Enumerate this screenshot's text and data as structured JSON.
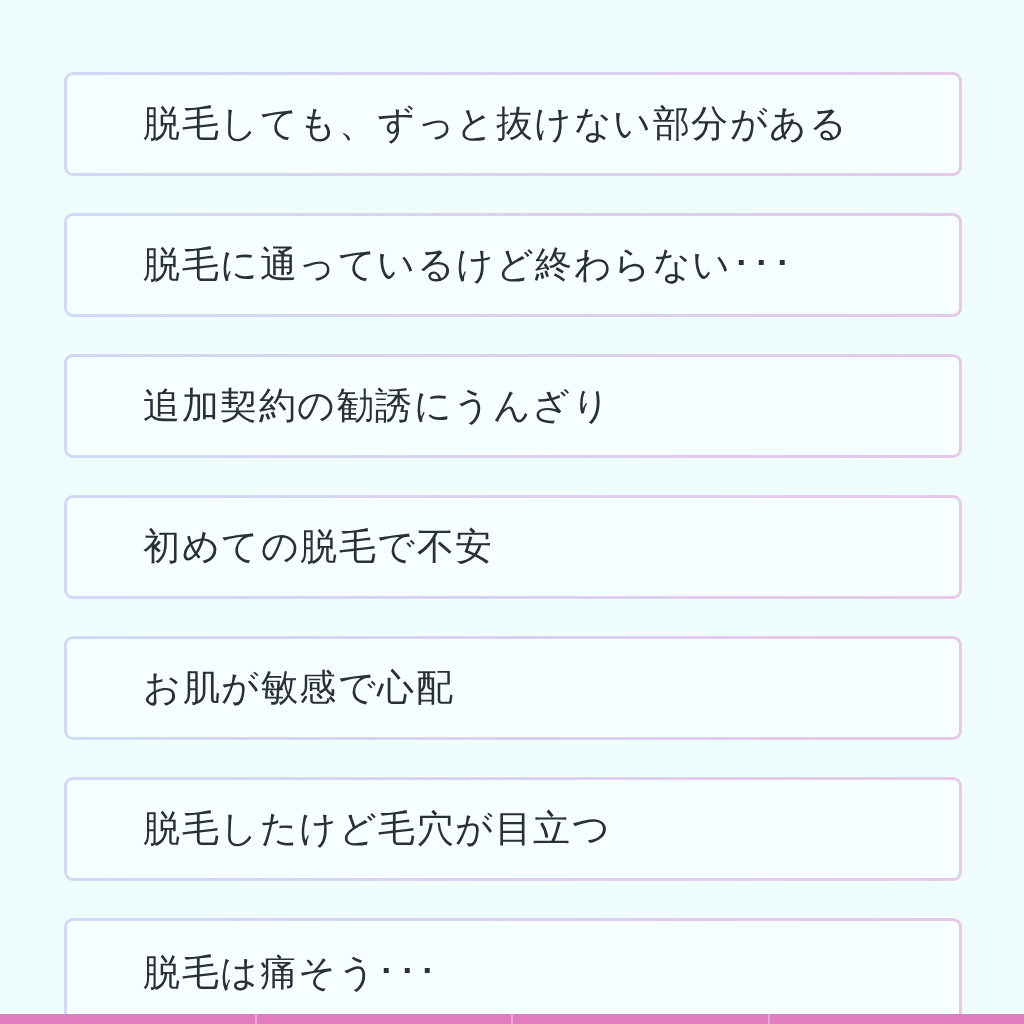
{
  "options": [
    {
      "text": "脱毛しても、ずっと抜けない部分がある"
    },
    {
      "text": "脱毛に通っているけど終わらない･･･"
    },
    {
      "text": "追加契約の勧誘にうんざり"
    },
    {
      "text": "初めての脱毛で不安"
    },
    {
      "text": "お肌が敏感で心配"
    },
    {
      "text": "脱毛したけど毛穴が目立つ"
    },
    {
      "text": "脱毛は痛そう･･･"
    }
  ]
}
